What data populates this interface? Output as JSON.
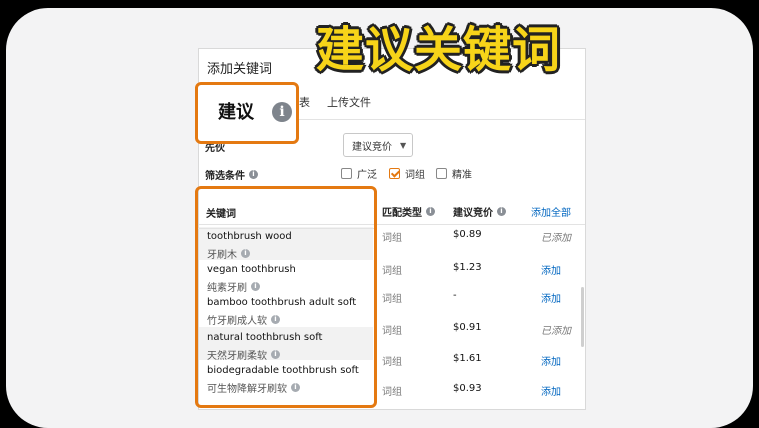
{
  "overlay_title": "建议关键词",
  "panel": {
    "title": "添加关键词",
    "suggest_tab": "建议",
    "tab_partial": "表",
    "upload_tab": "上传文件",
    "sort_label_partial": "先伙",
    "bid_dropdown": "建议竞价",
    "filter_label": "筛选条件",
    "filters": [
      {
        "label": "广泛",
        "checked": false
      },
      {
        "label": "词组",
        "checked": true
      },
      {
        "label": "精准",
        "checked": false
      }
    ]
  },
  "table": {
    "headers": {
      "keyword": "关键词",
      "match_type": "匹配类型",
      "suggested_bid": "建议竞价",
      "add_all": "添加全部"
    },
    "rows": [
      {
        "keyword": "toothbrush wood",
        "translation": "牙刷木",
        "match": "词组",
        "bid": "$0.89",
        "action": "已添加",
        "added": true
      },
      {
        "keyword": "vegan toothbrush",
        "translation": "纯素牙刷",
        "match": "词组",
        "bid": "$1.23",
        "action": "添加",
        "added": false
      },
      {
        "keyword": "bamboo toothbrush adult soft",
        "translation": "竹牙刷成人软",
        "match": "词组",
        "bid": "-",
        "action": "添加",
        "added": false
      },
      {
        "keyword": "natural toothbrush soft",
        "translation": "天然牙刷柔软",
        "match": "词组",
        "bid": "$0.91",
        "action": "已添加",
        "added": true
      },
      {
        "keyword": "biodegradable toothbrush soft",
        "translation": "可生物降解牙刷软",
        "match": "词组",
        "bid": "$1.61",
        "action": "添加",
        "added": false
      },
      {
        "keyword": "",
        "translation": "",
        "match": "词组",
        "bid": "$0.93",
        "action": "添加",
        "added": false
      }
    ]
  },
  "colors": {
    "accent_orange": "#e47911",
    "link_blue": "#0066c0",
    "overlay_yellow": "#f7d419"
  },
  "icons": [
    "info-icon",
    "chevron-down-icon",
    "checkbox-checked-icon"
  ]
}
